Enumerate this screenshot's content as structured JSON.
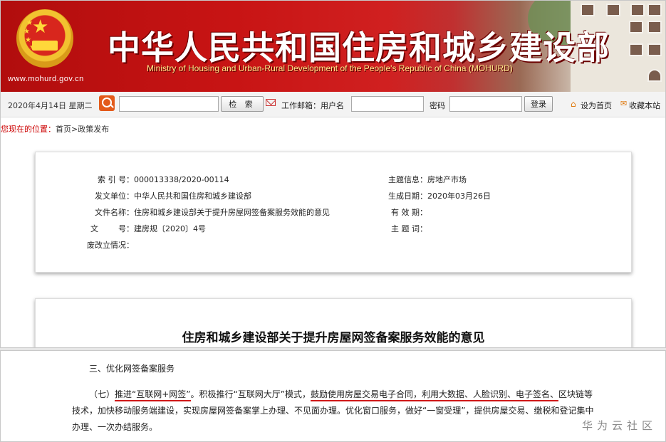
{
  "banner": {
    "title": "中华人民共和国住房和城乡建设部",
    "subtitle": "Ministry of Housing and Urban-Rural Development of the People's Republic of China (MOHURD)",
    "url": "www.mohurd.gov.cn"
  },
  "toolbar": {
    "date": "2020年4月14日 星期二",
    "search_button": "检 索",
    "login_label": "工作邮箱：用户名",
    "password_label": "密码",
    "login_button": "登录",
    "set_home": "设为首页",
    "bookmark": "收藏本站"
  },
  "breadcrumb": {
    "prefix": "您现在的位置：",
    "path": "首页>政策发布"
  },
  "meta": {
    "index_no": {
      "key": "索 引 号：",
      "value": "000013338/2020-00114"
    },
    "issuer": {
      "key": "发文单位：",
      "value": "中华人民共和国住房和城乡建设部"
    },
    "file_name": {
      "key": "文件名称：",
      "value": "住房和城乡建设部关于提升房屋网签备案服务效能的意见"
    },
    "doc_no": {
      "key": "文        号：",
      "value": "建房规〔2020〕4号"
    },
    "repeal": {
      "key": "废改立情况：",
      "value": ""
    },
    "topic": {
      "key": "主题信息：",
      "value": "房地产市场"
    },
    "effective_date": {
      "key": "生成日期：",
      "value": "2020年03月26日"
    },
    "validity": {
      "key": "有 效 期：",
      "value": ""
    },
    "keywords": {
      "key": "主 题 词：",
      "value": ""
    }
  },
  "document": {
    "title": "住房和城乡建设部关于提升房屋网签备案服务效能的意见",
    "section_heading": "三、优化网签备案服务",
    "para_p1": "（七）",
    "para_u1": "推进“互联网+网签”",
    "para_p2": "。积极推行“互联网大厅”模式，",
    "para_u2": "鼓励使用房屋交易电子合同，利用大数据、人脸识别、电子签",
    "para_u3": "名、",
    "para_p3": "区块链等技术，加快移动服务端建设，实现房屋网签备案掌上办理、不见面办理。优化窗口服务，做好“一窗受理”，提供房屋交易、缴税和登记集中办理、一次办结服务。"
  },
  "watermark": "华为云社区",
  "colors": {
    "brand_red": "#c81414",
    "underline_red": "#d01818",
    "accent_orange": "#e35a1a"
  },
  "icons": [
    "national-emblem-icon",
    "search-icon",
    "mail-icon",
    "home-icon",
    "bookmark-icon"
  ]
}
